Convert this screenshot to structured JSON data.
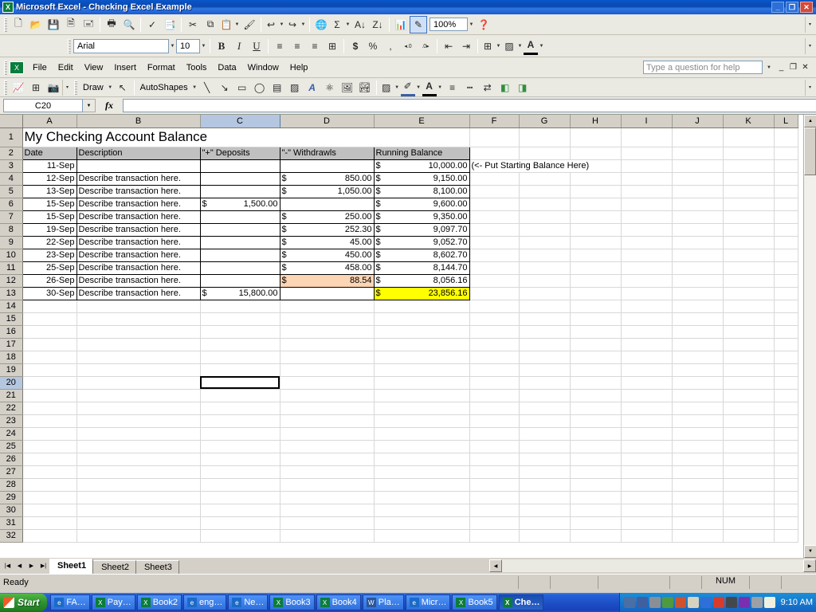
{
  "window": {
    "title": "Microsoft Excel - Checking Excel Example",
    "app_icon": "excel-icon",
    "minimize": "_",
    "restore": "❐",
    "close": "✕"
  },
  "menubar": {
    "items": [
      "File",
      "Edit",
      "View",
      "Insert",
      "Format",
      "Tools",
      "Data",
      "Window",
      "Help"
    ],
    "ask_placeholder": "Type a question for help",
    "doc_minimize": "_",
    "doc_restore": "❐",
    "doc_close": "✕"
  },
  "standard_toolbar": {
    "buttons": [
      {
        "name": "new-icon",
        "glyph": "🗋"
      },
      {
        "name": "open-icon",
        "glyph": "📂"
      },
      {
        "name": "save-icon",
        "glyph": "💾"
      },
      {
        "name": "permission-icon",
        "glyph": "🗎"
      },
      {
        "name": "email-icon",
        "glyph": "🖃"
      },
      {
        "name": "print-icon",
        "glyph": "🖶"
      },
      {
        "name": "print-preview-icon",
        "glyph": "🔍"
      },
      {
        "name": "spelling-icon",
        "glyph": "ABC"
      },
      {
        "name": "research-icon",
        "glyph": "📑"
      },
      {
        "name": "cut-icon",
        "glyph": "✂"
      },
      {
        "name": "copy-icon",
        "glyph": "⧉"
      },
      {
        "name": "paste-icon",
        "glyph": "📋"
      },
      {
        "name": "format-painter-icon",
        "glyph": "🖌"
      },
      {
        "name": "undo-icon",
        "glyph": "↩"
      },
      {
        "name": "redo-icon",
        "glyph": "↪"
      },
      {
        "name": "hyperlink-icon",
        "glyph": "🌐"
      },
      {
        "name": "autosum-icon",
        "glyph": "Σ"
      },
      {
        "name": "sort-ascending-icon",
        "glyph": "A↓"
      },
      {
        "name": "sort-descending-icon",
        "glyph": "Z↓"
      },
      {
        "name": "chart-wizard-icon",
        "glyph": "📊"
      },
      {
        "name": "drawing-toggle-icon",
        "glyph": "✎"
      },
      {
        "name": "help-icon",
        "glyph": "❓"
      }
    ],
    "zoom_value": "100%"
  },
  "formatting_toolbar": {
    "font_name": "Arial",
    "font_size": "10",
    "bold": "B",
    "italic": "I",
    "underline": "U",
    "align_left": "≡",
    "align_center": "≡",
    "align_right": "≡",
    "merge_center": "⊞",
    "currency": "$",
    "percent": "%",
    "comma": ",",
    "increase_decimal": "+.0",
    "decrease_decimal": "-.0",
    "decrease_indent": "⇤",
    "increase_indent": "⇥",
    "borders": "⊞",
    "fill_color": "▨",
    "font_color": "A"
  },
  "drawing_toolbar": {
    "draw_label": "Draw",
    "autoshapes_label": "AutoShapes",
    "buttons": [
      {
        "name": "insert-chart-icon",
        "glyph": "📈"
      },
      {
        "name": "insert-table-icon",
        "glyph": "⊞"
      },
      {
        "name": "camera-icon",
        "glyph": "📷"
      },
      {
        "name": "select-objects-icon",
        "glyph": "↖"
      },
      {
        "name": "line-icon",
        "glyph": "╲"
      },
      {
        "name": "arrow-icon",
        "glyph": "↘"
      },
      {
        "name": "rectangle-icon",
        "glyph": "▭"
      },
      {
        "name": "oval-icon",
        "glyph": "◯"
      },
      {
        "name": "text-box-icon",
        "glyph": "▤"
      },
      {
        "name": "insert-diagram-icon",
        "glyph": "▨"
      },
      {
        "name": "wordart-icon",
        "glyph": "A"
      },
      {
        "name": "organization-chart-icon",
        "glyph": "⚛"
      },
      {
        "name": "clip-art-icon",
        "glyph": "🖼"
      },
      {
        "name": "picture-icon",
        "glyph": "🏞"
      },
      {
        "name": "fill-color-icon",
        "glyph": "▨"
      },
      {
        "name": "line-color-icon",
        "glyph": "✐"
      },
      {
        "name": "font-color-icon",
        "glyph": "A"
      },
      {
        "name": "line-style-icon",
        "glyph": "≡"
      },
      {
        "name": "dash-style-icon",
        "glyph": "┄"
      },
      {
        "name": "arrow-style-icon",
        "glyph": "⇄"
      },
      {
        "name": "shadow-style-icon",
        "glyph": "◧"
      },
      {
        "name": "3d-style-icon",
        "glyph": "◨"
      }
    ]
  },
  "formula_bar": {
    "name_box": "C20",
    "fx_label": "fx",
    "formula_value": ""
  },
  "sheet": {
    "columns": [
      {
        "label": "A",
        "width": 68
      },
      {
        "label": "B",
        "width": 155
      },
      {
        "label": "C",
        "width": 100
      },
      {
        "label": "D",
        "width": 118
      },
      {
        "label": "E",
        "width": 120
      },
      {
        "label": "F",
        "width": 62
      },
      {
        "label": "G",
        "width": 64
      },
      {
        "label": "H",
        "width": 64
      },
      {
        "label": "I",
        "width": 64
      },
      {
        "label": "J",
        "width": 64
      },
      {
        "label": "K",
        "width": 64
      },
      {
        "label": "L",
        "width": 30
      }
    ],
    "selected_cell": "C20",
    "selected_column": "C",
    "selected_row": 20,
    "title_row": {
      "row": 1,
      "text": "My Checking Account Balance"
    },
    "header_row": {
      "row": 2,
      "cells": [
        "Date",
        "Description",
        "\"+\" Deposits",
        "\"-\" Withdrawls",
        "Running  Balance"
      ]
    },
    "note": {
      "row": 3,
      "column": "F",
      "text": "(<- Put Starting Balance Here)"
    },
    "rows": [
      {
        "row": 3,
        "date": "11-Sep",
        "desc": "",
        "deposit": "",
        "withdrawal": "",
        "balance": "10,000.00",
        "balance_hl": ""
      },
      {
        "row": 4,
        "date": "12-Sep",
        "desc": "Describe transaction here.",
        "deposit": "",
        "withdrawal": "850.00",
        "balance": "9,150.00",
        "balance_hl": ""
      },
      {
        "row": 5,
        "date": "13-Sep",
        "desc": "Describe transaction here.",
        "deposit": "",
        "withdrawal": "1,050.00",
        "balance": "8,100.00",
        "balance_hl": ""
      },
      {
        "row": 6,
        "date": "15-Sep",
        "desc": "Describe transaction here.",
        "deposit": "1,500.00",
        "withdrawal": "",
        "balance": "9,600.00",
        "balance_hl": ""
      },
      {
        "row": 7,
        "date": "15-Sep",
        "desc": "Describe transaction here.",
        "deposit": "",
        "withdrawal": "250.00",
        "balance": "9,350.00",
        "balance_hl": ""
      },
      {
        "row": 8,
        "date": "19-Sep",
        "desc": "Describe transaction here.",
        "deposit": "",
        "withdrawal": "252.30",
        "balance": "9,097.70",
        "balance_hl": ""
      },
      {
        "row": 9,
        "date": "22-Sep",
        "desc": "Describe transaction here.",
        "deposit": "",
        "withdrawal": "45.00",
        "balance": "9,052.70",
        "balance_hl": ""
      },
      {
        "row": 10,
        "date": "23-Sep",
        "desc": "Describe transaction here.",
        "deposit": "",
        "withdrawal": "450.00",
        "balance": "8,602.70",
        "balance_hl": ""
      },
      {
        "row": 11,
        "date": "25-Sep",
        "desc": "Describe transaction here.",
        "deposit": "",
        "withdrawal": "458.00",
        "balance": "8,144.70",
        "balance_hl": ""
      },
      {
        "row": 12,
        "date": "26-Sep",
        "desc": "Describe transaction here.",
        "deposit": "",
        "withdrawal": "88.54",
        "withdrawal_hl": "orange",
        "balance": "8,056.16",
        "balance_hl": ""
      },
      {
        "row": 13,
        "date": "30-Sep",
        "desc": "Describe transaction here.",
        "deposit": "15,800.00",
        "withdrawal": "",
        "balance": "23,856.16",
        "balance_hl": "yellow"
      },
      {
        "row": 14,
        "date": "",
        "desc": "",
        "deposit": "",
        "withdrawal": "",
        "balance": "",
        "balance_hl": ""
      }
    ],
    "empty_rows": [
      15,
      16,
      17,
      18,
      19,
      20,
      21,
      22,
      23,
      24,
      25,
      26,
      27,
      28,
      29,
      30,
      31,
      32
    ],
    "currency_symbol": "$",
    "highlight_colors": {
      "orange": "#fcd5b4",
      "yellow": "#ffff00",
      "header_gray": "#c0c0c0"
    }
  },
  "tabs": {
    "nav": [
      "⏮",
      "◀",
      "▶",
      "⏭"
    ],
    "sheets": [
      {
        "label": "Sheet1",
        "active": true
      },
      {
        "label": "Sheet2",
        "active": false
      },
      {
        "label": "Sheet3",
        "active": false
      }
    ]
  },
  "status_bar": {
    "message": "Ready",
    "num_lock": "NUM"
  },
  "taskbar": {
    "start_label": "Start",
    "tasks": [
      {
        "label": "FA…",
        "icon": "ie"
      },
      {
        "label": "Pay…",
        "icon": "xl"
      },
      {
        "label": "Book2",
        "icon": "xl"
      },
      {
        "label": "eng…",
        "icon": "ie"
      },
      {
        "label": "Ne…",
        "icon": "ie"
      },
      {
        "label": "Book3",
        "icon": "xl"
      },
      {
        "label": "Book4",
        "icon": "xl"
      },
      {
        "label": "Pla…",
        "icon": "wd"
      },
      {
        "label": "Micr…",
        "icon": "ie"
      },
      {
        "label": "Book5",
        "icon": "xl"
      },
      {
        "label": "Che…",
        "icon": "xl",
        "active": true
      }
    ],
    "clock": "9:10 AM"
  }
}
